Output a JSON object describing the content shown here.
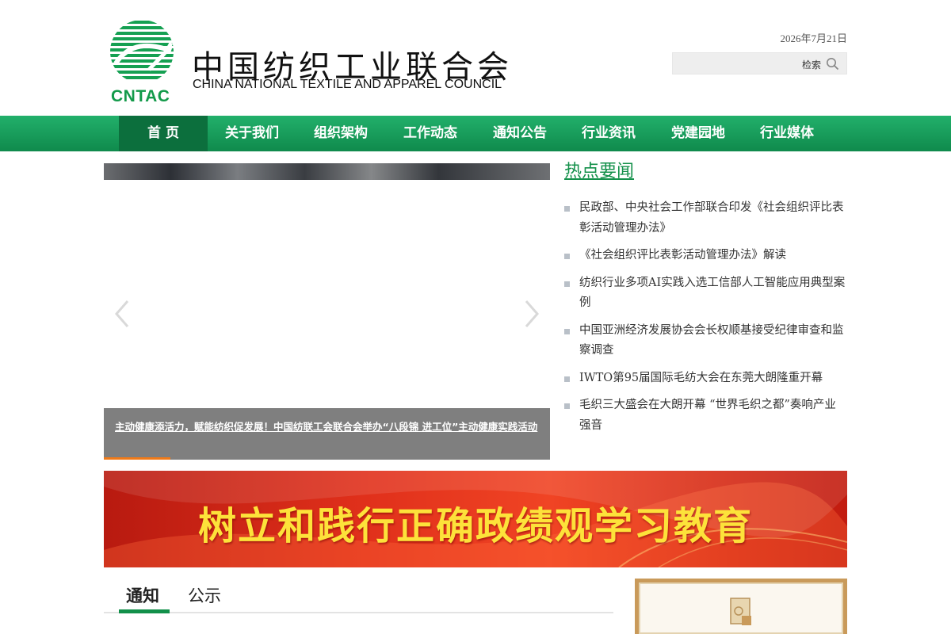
{
  "header": {
    "logo_abbr": "CNTAC",
    "org_name_cn": "中国纺织工业联合会",
    "org_name_en": "CHINA NATIONAL TEXTILE AND APPAREL COUNCIL",
    "date": "2026年7月21日",
    "search": {
      "label": "检索",
      "icon": "search-icon"
    }
  },
  "nav": {
    "items": [
      {
        "label": "首 页",
        "active": true
      },
      {
        "label": "关于我们"
      },
      {
        "label": "组织架构"
      },
      {
        "label": "工作动态"
      },
      {
        "label": "通知公告"
      },
      {
        "label": "行业资讯"
      },
      {
        "label": "党建园地"
      },
      {
        "label": "行业媒体"
      }
    ]
  },
  "carousel": {
    "caption": "主动健康添活力，赋能纺织促发展！中国纺联工会联合会举办“八段锦 进工位”主动健康实践活动",
    "prev_icon": "chevron-left-icon",
    "next_icon": "chevron-right-icon"
  },
  "hot_news": {
    "title": "热点要闻",
    "items": [
      "民政部、中央社会工作部联合印发《社会组织评比表彰活动管理办法》",
      "《社会组织评比表彰活动管理办法》解读",
      "纺织行业多项AI实践入选工信部人工智能应用典型案例",
      "中国亚洲经济发展协会会长权顺基接受纪律审查和监察调查",
      "IWTO第95届国际毛纺大会在东莞大朗隆重开幕",
      "毛织三大盛会在大朗开幕 “世界毛织之都”奏响产业强音"
    ]
  },
  "banner": {
    "text": "树立和践行正确政绩观学习教育"
  },
  "tabs": {
    "items": [
      "通知",
      "公示"
    ],
    "active": "通知"
  },
  "colors": {
    "brand_green": "#13904a",
    "nav_active": "#0c6f3d",
    "banner_red": "#e0301b",
    "banner_text": "#fde23a"
  }
}
